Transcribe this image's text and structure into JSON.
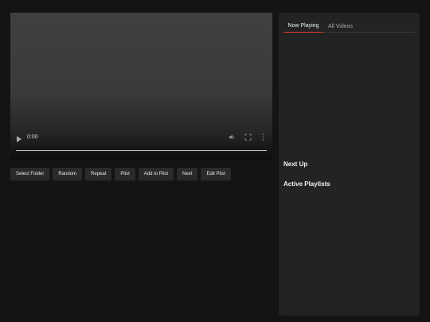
{
  "player": {
    "time": "0:00",
    "icons": {
      "play": "play-icon",
      "mute": "volume-icon",
      "fullscreen": "fullscreen-icon",
      "more": "more-vertical-icon"
    },
    "progress_fraction": 0
  },
  "buttons": [
    {
      "label": "Select Folder"
    },
    {
      "label": "Random"
    },
    {
      "label": "Repeat"
    },
    {
      "label": "Plist"
    },
    {
      "label": "Add to Plist"
    },
    {
      "label": "Next"
    },
    {
      "label": "Edit Plist"
    }
  ],
  "sidebar": {
    "tabs": [
      {
        "label": "Now Playing",
        "active": true
      },
      {
        "label": "All Videos",
        "active": false
      }
    ],
    "next_up_heading": "Next Up",
    "active_playlists_heading": "Active Playlists"
  },
  "colors": {
    "background": "#141414",
    "panel": "#232323",
    "button": "#2a2a2a",
    "accent": "#e53935"
  }
}
